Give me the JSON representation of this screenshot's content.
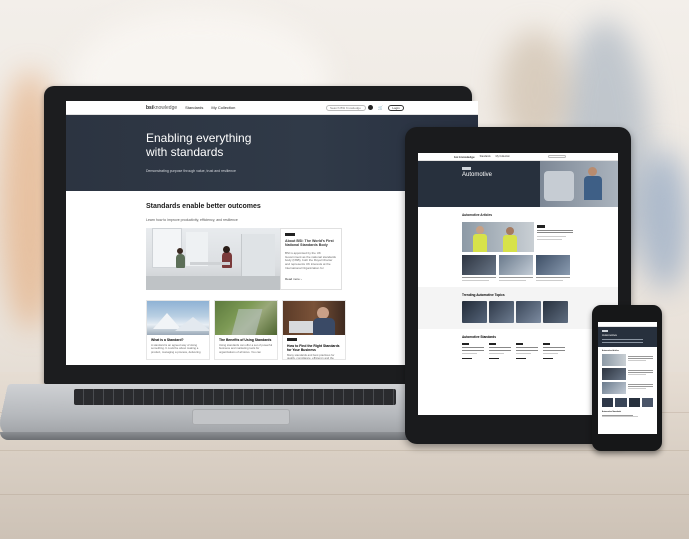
{
  "laptop": {
    "nav": {
      "logo_main": "bsi",
      "logo_sub": "knowledge",
      "item_1": "Standards",
      "item_2": "My Collection",
      "search_placeholder": "Search BSI Knowledge",
      "login": "Login"
    },
    "hero": {
      "title_line1": "Enabling everything",
      "title_line2": "with standards",
      "tagline": "Demonstrating purpose through value, trust and resilience"
    },
    "section": {
      "title": "Standards enable better outcomes",
      "subtitle": "Learn how to improve productivity, efficiency, and resilience"
    },
    "feature": {
      "title": "About BSI: The World's First National Standards Body",
      "body": "BSI is appointed by the UK Government as the national standards body (NSB), both the Royal Charter and represents UK interests at the International Organization for",
      "read_more": "Read more  ›"
    },
    "cards": [
      {
        "title": "What is a Standard?",
        "body": "A standard is an agreed way of doing something. It could be about making a product, managing a process, delivering"
      },
      {
        "title": "The Benefits of Using Standards",
        "body": "Using standards can offer a set of powerful business and marketing tools for organizations of all sizes. You can"
      },
      {
        "title": "How to Find the Right Standards for Your Business",
        "body": "Many standards and best practices for quality, compliance, efficiency and the"
      }
    ]
  },
  "tablet": {
    "nav": {
      "logo": "bsi knowledge",
      "item_1": "Standards",
      "item_2": "My Collection"
    },
    "hero": {
      "title": "Automotive"
    },
    "articles_title": "Automotive Articles",
    "trending_title": "Trending Automotive Topics",
    "standards_title": "Automotive Standards"
  },
  "phone": {
    "hero_title": "Automotive",
    "articles_title": "Automotive Articles",
    "standards_title": "Automotive Standards"
  }
}
